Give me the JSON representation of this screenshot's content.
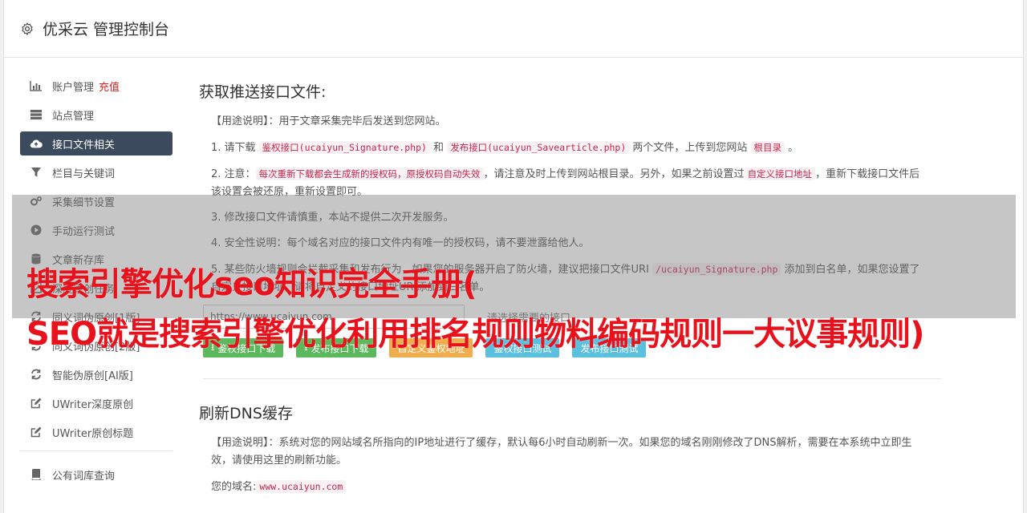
{
  "header": {
    "title": "优采云 管理控制台"
  },
  "sidebar": {
    "items": [
      {
        "label": "账户管理",
        "badge": "充值",
        "icon": "bar-chart-icon"
      },
      {
        "label": "站点管理",
        "icon": "server-icon"
      },
      {
        "label": "接口文件相关",
        "icon": "cloud-upload-icon",
        "active": true
      },
      {
        "label": "栏目与关键词",
        "icon": "filter-icon"
      },
      {
        "label": "采集细节设置",
        "icon": "gears-icon"
      },
      {
        "label": "手动运行测试",
        "icon": "play-circle-icon"
      },
      {
        "label": "文章新存库",
        "icon": "database-icon"
      },
      {
        "label": "深度原创任务",
        "icon": "tasks-icon"
      },
      {
        "label": "同义词伪原创[1版]",
        "icon": "refresh-icon"
      },
      {
        "label": "同义词伪原创[2版]",
        "icon": "refresh-icon"
      },
      {
        "label": "智能伪原创[AI版]",
        "icon": "refresh-icon"
      },
      {
        "label": "UWriter深度原创",
        "icon": "edit-icon"
      },
      {
        "label": "UWriter原创标题",
        "icon": "edit-icon"
      },
      {
        "label": "公有词库查询",
        "icon": "book-icon"
      }
    ]
  },
  "main": {
    "section1": {
      "title": "获取推送接口文件:",
      "usage_label": "【用途说明】",
      "usage_text": "：用于文章采集完毕后发送到您网站。",
      "step1_a": "1. 请下载 ",
      "step1_code1": "鉴权接口(ucaiyun_Signature.php)",
      "step1_b": " 和 ",
      "step1_code2": "发布接口(ucaiyun_Savearticle.php)",
      "step1_c": " 两个文件，上传到您网站 ",
      "step1_code3": "根目录",
      "step1_d": " 。",
      "step2_a": "2. 注意：",
      "step2_code1": "每次重新下载都会生成新的授权码，原授权码自动失效",
      "step2_b": "，请注意及时上传到网站根目录。另外，如果之前设置过",
      "step2_code2": "自定义接口地址",
      "step2_c": "，重新下载接口文件后该设置会被还原，重新设置即可。",
      "step3": "3. 修改接口文件请慎重，本站不提供二次开发服务。",
      "step4": "4. 安全性说明：每个域名对应的接口文件内有唯一的授权码，请不要泄露给他人。",
      "step5_a": "5. 某些防火墙规则会拦截采集和发布行为，如果您的服务器开启了防火墙，建议把接口文件URI ",
      "step5_code": "/ucaiyun_Signature.php",
      "step5_b": " 添加到白名单，如果您设置了自定义接口地址，请将自定义的接口地址URI添加到白名单。",
      "url_value": "https://www.ucaiyun.com",
      "select_label": "请选择需要的接口",
      "buttons": {
        "download_sign": "鉴权接口下载",
        "download_publish": "发布接口下载",
        "custom_sign": "自定义鉴权地址",
        "test_sign": "鉴权接口测试",
        "test_publish": "发布接口测试"
      }
    },
    "section2": {
      "title": "刷新DNS缓存",
      "usage_label": "【用途说明】",
      "usage_text": "：系统对您的网站域名所指向的IP地址进行了缓存，默认每6小时自动刷新一次。如果您的域名刚刚修改了DNS解析，需要在本系统中立即生效，请使用这里的刷新功能。",
      "domain_label": "您的域名:",
      "domain_value": "www.ucaiyun.com"
    }
  },
  "overlay": {
    "line1": "搜索引擎优化seo知识完全手册(",
    "line2": "SEO就是搜索引擎优化利用排名规则物料编码规则一大议事规则)"
  },
  "colors": {
    "active_nav": "#3c4a5d",
    "green_btn": "#5cb85c",
    "orange_btn": "#f0ad4e",
    "blue_btn": "#5bc0de",
    "overlay_text": "#e8121c",
    "code_text": "#c7254e"
  }
}
